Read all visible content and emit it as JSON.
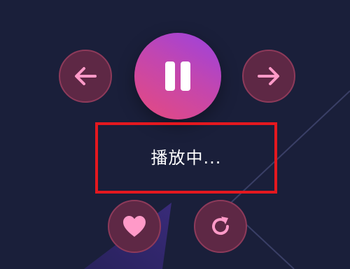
{
  "player": {
    "status_text": "播放中..."
  },
  "icons": {
    "previous": "arrow-left-icon",
    "play_pause": "pause-icon",
    "next": "arrow-right-icon",
    "like": "heart-icon",
    "repeat": "refresh-icon"
  },
  "colors": {
    "background": "#1a1f3a",
    "icon_pink": "#ff9ac8",
    "button_fill": "#5e2845",
    "button_border": "#8e3a5a",
    "play_gradient_start": "#9a42e0",
    "play_gradient_end": "#e64a7e",
    "highlight_box": "#e4181f"
  }
}
